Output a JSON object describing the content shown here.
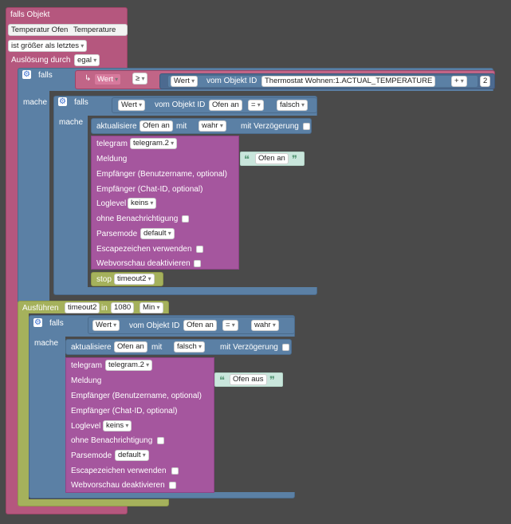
{
  "event": {
    "title": "falls Objekt",
    "object_name": "Temperatur Ofen",
    "object_type": "Temperature",
    "condition": "ist größer als letztes",
    "trigger_label": "Auslösung durch",
    "trigger_value": "egal"
  },
  "if1": {
    "falls": "falls",
    "mache": "mache",
    "var_label": "Wert",
    "op": "≥",
    "get_label": "Wert",
    "vom_objekt_id": "vom Objekt ID",
    "object_id": "Thermostat Wohnen:1.ACTUAL_TEMPERATURE",
    "math_op": "+",
    "number": "2"
  },
  "if2": {
    "falls": "falls",
    "mache": "mache",
    "get_label": "Wert",
    "vom_objekt_id": "vom Objekt ID",
    "object": "Ofen an",
    "op": "=",
    "value": "falsch"
  },
  "update1": {
    "label": "aktualisiere",
    "object": "Ofen an",
    "mit": "mit",
    "value": "wahr",
    "delay": "mit Verzögerung"
  },
  "telegram1": {
    "label": "telegram",
    "instance": "telegram.2",
    "meldung": "Meldung",
    "message": "Ofen an",
    "recipient_user": "Empfänger (Benutzername, optional)",
    "recipient_chat": "Empfänger (Chat-ID, optional)",
    "loglevel": "Loglevel",
    "loglevel_value": "keins",
    "no_notify": "ohne Benachrichtigung",
    "parsemode": "Parsemode",
    "parsemode_value": "default",
    "escape": "Escapezeichen verwenden",
    "no_preview": "Webvorschau deaktivieren"
  },
  "stop": {
    "label": "stop",
    "timeout": "timeout2"
  },
  "exec": {
    "label": "Ausführen",
    "timeout": "timeout2",
    "in": "in",
    "amount": "1080",
    "unit": "Min"
  },
  "if3": {
    "falls": "falls",
    "mache": "mache",
    "get_label": "Wert",
    "vom_objekt_id": "vom Objekt ID",
    "object": "Ofen an",
    "op": "=",
    "value": "wahr"
  },
  "update2": {
    "label": "aktualisiere",
    "object": "Ofen an",
    "mit": "mit",
    "value": "falsch",
    "delay": "mit Verzögerung"
  },
  "telegram2": {
    "label": "telegram",
    "instance": "telegram.2",
    "meldung": "Meldung",
    "message": "Ofen aus",
    "recipient_user": "Empfänger (Benutzername, optional)",
    "recipient_chat": "Empfänger (Chat-ID, optional)",
    "loglevel": "Loglevel",
    "loglevel_value": "keins",
    "no_notify": "ohne Benachrichtigung",
    "parsemode": "Parsemode",
    "parsemode_value": "default",
    "escape": "Escapezeichen verwenden",
    "no_preview": "Webvorschau deaktivieren"
  }
}
